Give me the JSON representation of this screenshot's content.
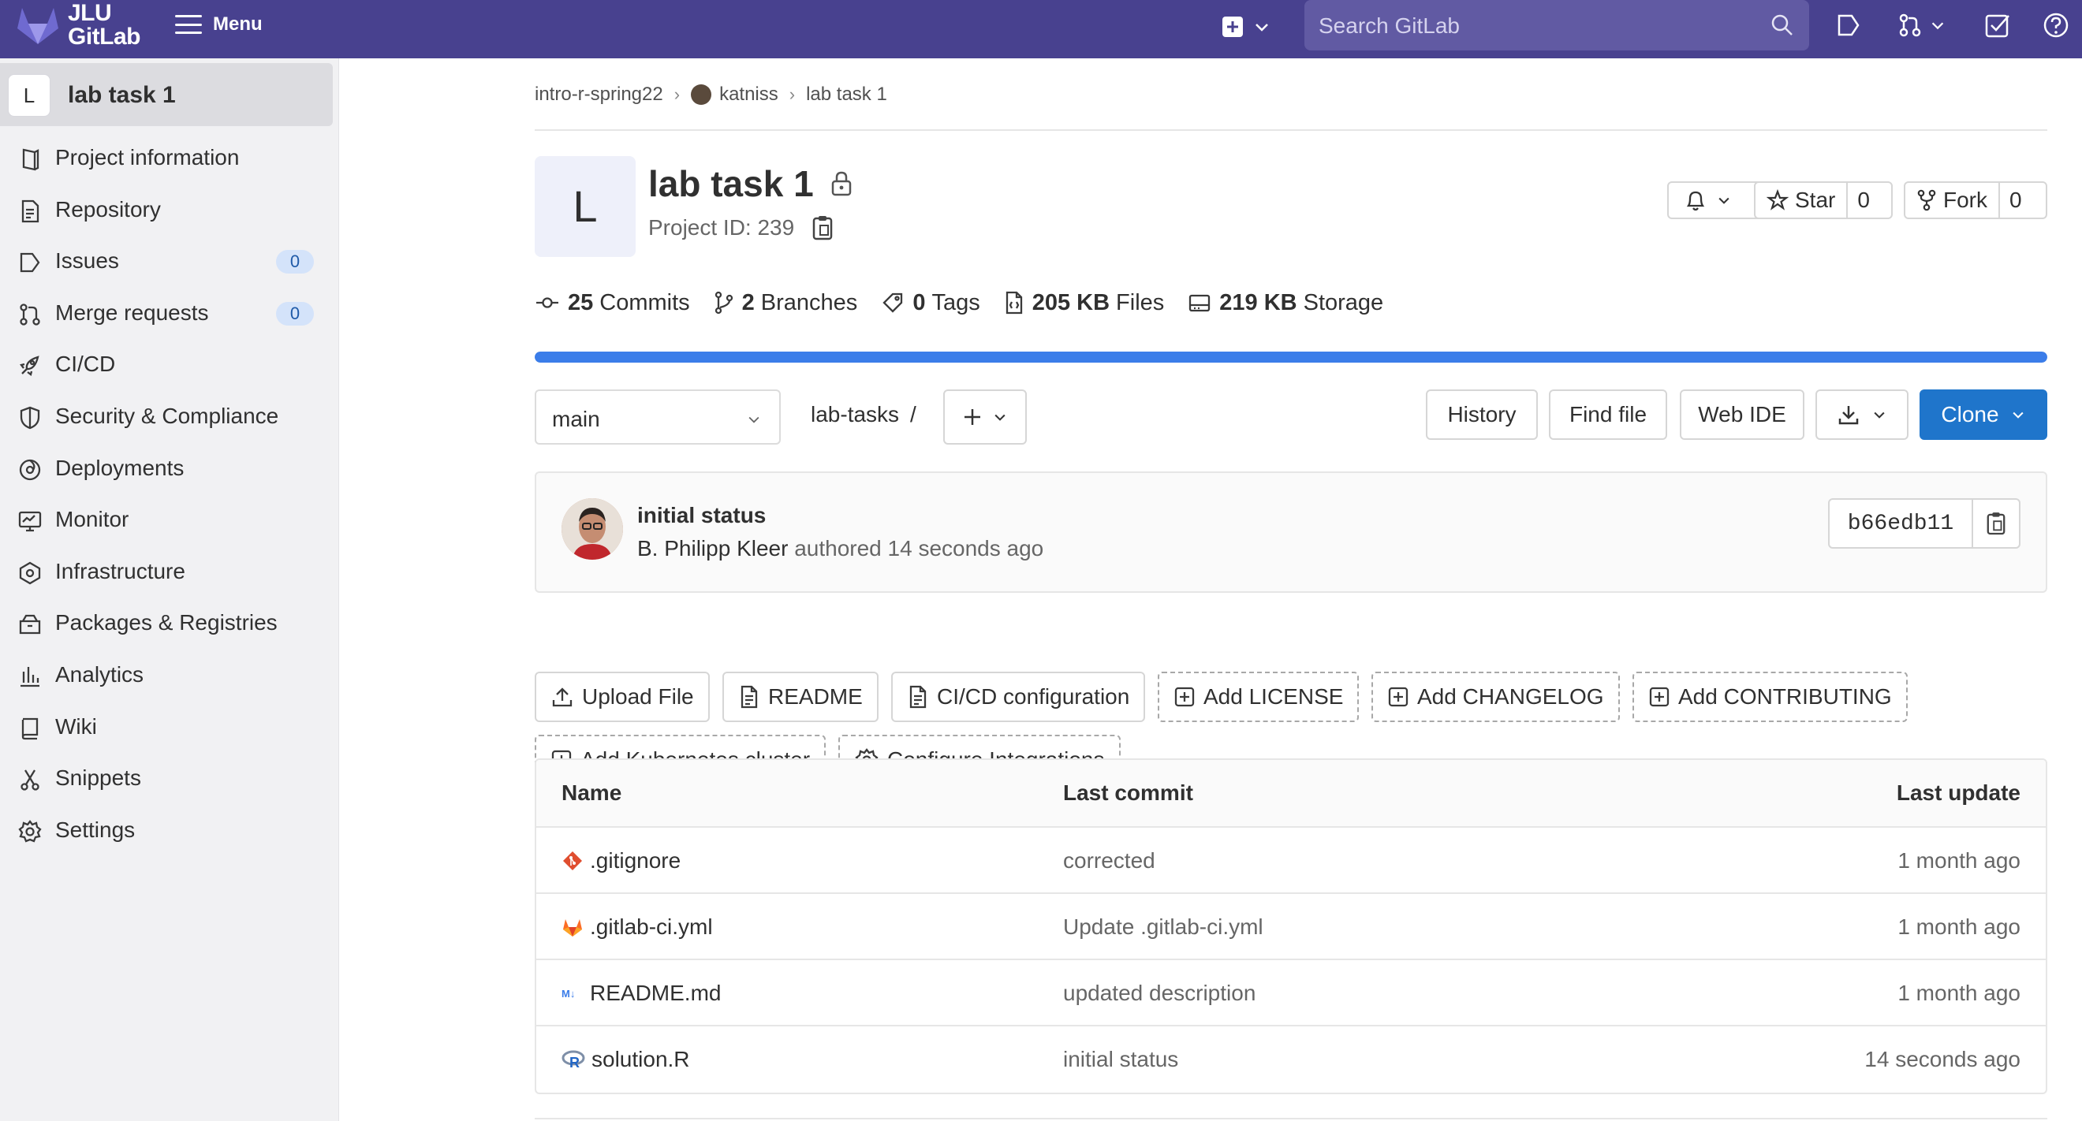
{
  "topbar": {
    "logo_line1": "JLU",
    "logo_line2": "GitLab",
    "menu_label": "Menu",
    "search_placeholder": "Search GitLab",
    "colors": {
      "bg": "#48418f",
      "search_bg": "#615aa3"
    }
  },
  "sidebar": {
    "project_avatar": "L",
    "project_name": "lab task 1",
    "items": [
      {
        "label": "Project information",
        "icon": "project-info-icon"
      },
      {
        "label": "Repository",
        "icon": "repository-icon"
      },
      {
        "label": "Issues",
        "icon": "issues-icon",
        "count": "0"
      },
      {
        "label": "Merge requests",
        "icon": "merge-request-icon",
        "count": "0"
      },
      {
        "label": "CI/CD",
        "icon": "rocket-icon"
      },
      {
        "label": "Security & Compliance",
        "icon": "shield-icon"
      },
      {
        "label": "Deployments",
        "icon": "deployments-icon"
      },
      {
        "label": "Monitor",
        "icon": "monitor-icon"
      },
      {
        "label": "Infrastructure",
        "icon": "infrastructure-icon"
      },
      {
        "label": "Packages & Registries",
        "icon": "package-icon"
      },
      {
        "label": "Analytics",
        "icon": "analytics-icon"
      },
      {
        "label": "Wiki",
        "icon": "book-icon"
      },
      {
        "label": "Snippets",
        "icon": "snippet-icon"
      },
      {
        "label": "Settings",
        "icon": "gear-icon"
      }
    ]
  },
  "breadcrumb": [
    "intro-r-spring22",
    "katniss",
    "lab task 1"
  ],
  "project": {
    "avatar": "L",
    "title": "lab task 1",
    "id_text": "Project ID: 239",
    "star_label": "Star",
    "star_count": "0",
    "fork_label": "Fork",
    "fork_count": "0"
  },
  "stats": [
    {
      "value": "25",
      "label": "Commits",
      "icon": "commit-icon"
    },
    {
      "value": "2",
      "label": "Branches",
      "icon": "branch-icon"
    },
    {
      "value": "0",
      "label": "Tags",
      "icon": "tag-icon"
    },
    {
      "value": "205 KB",
      "label": "Files",
      "icon": "file-icon"
    },
    {
      "value": "219 KB",
      "label": "Storage",
      "icon": "storage-icon"
    }
  ],
  "storage_bar_fraction": 1.0,
  "repo_toolbar": {
    "branch": "main",
    "path": "lab-tasks",
    "path_sep": "/",
    "history": "History",
    "find_file": "Find file",
    "web_ide": "Web IDE",
    "clone": "Clone"
  },
  "last_commit": {
    "message": "initial status",
    "author": "B. Philipp Kleer",
    "meta": "authored 14 seconds ago",
    "sha": "b66edb11"
  },
  "quick_actions": [
    {
      "label": "Upload File",
      "style": "solid",
      "icon": "upload-icon"
    },
    {
      "label": "README",
      "style": "solid",
      "icon": "doc-icon"
    },
    {
      "label": "CI/CD configuration",
      "style": "solid",
      "icon": "doc-icon"
    },
    {
      "label": "Add LICENSE",
      "style": "dashed",
      "icon": "plus-square-icon"
    },
    {
      "label": "Add CHANGELOG",
      "style": "dashed",
      "icon": "plus-square-icon"
    },
    {
      "label": "Add CONTRIBUTING",
      "style": "dashed",
      "icon": "plus-square-icon"
    },
    {
      "label": "Add Kubernetes cluster",
      "style": "dashed",
      "icon": "plus-square-icon"
    },
    {
      "label": "Configure Integrations",
      "style": "dashed",
      "icon": "gear-icon"
    }
  ],
  "files": {
    "headers": [
      "Name",
      "Last commit",
      "Last update"
    ],
    "rows": [
      {
        "name": ".gitignore",
        "icon": "git-icon",
        "commit": "corrected",
        "updated": "1 month ago"
      },
      {
        "name": ".gitlab-ci.yml",
        "icon": "gitlab-icon",
        "commit": "Update .gitlab-ci.yml",
        "updated": "1 month ago"
      },
      {
        "name": "README.md",
        "icon": "markdown-icon",
        "commit": "updated description",
        "updated": "1 month ago"
      },
      {
        "name": "solution.R",
        "icon": "r-lang-icon",
        "commit": "initial status",
        "updated": "14 seconds ago"
      }
    ]
  }
}
